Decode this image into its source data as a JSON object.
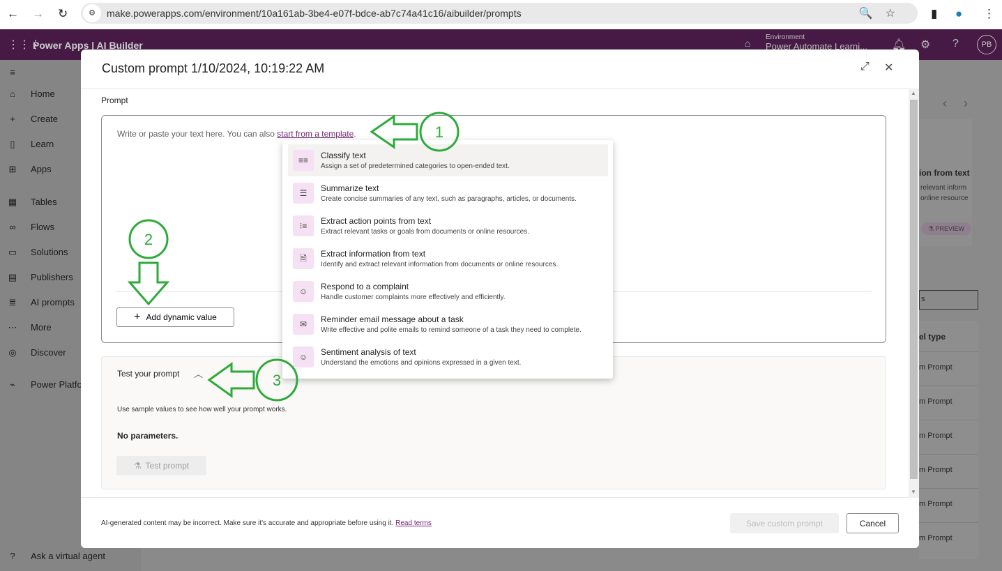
{
  "browser": {
    "url": "make.powerapps.com/environment/10a161ab-3be4-e07f-bdce-ab7c74a41c16/aibuilder/prompts"
  },
  "app": {
    "title": "Power Apps | AI Builder",
    "environment_label": "Environment",
    "environment_name": "Power Automate Learni...",
    "avatar": "PB"
  },
  "sidebar": {
    "items": [
      {
        "icon": "home-icon",
        "label": "Home"
      },
      {
        "icon": "plus-icon",
        "label": "Create"
      },
      {
        "icon": "book-icon",
        "label": "Learn"
      },
      {
        "icon": "apps-icon",
        "label": "Apps"
      },
      {
        "icon": "table-icon",
        "label": "Tables"
      },
      {
        "icon": "flow-icon",
        "label": "Flows"
      },
      {
        "icon": "solutions-icon",
        "label": "Solutions"
      },
      {
        "icon": "publisher-icon",
        "label": "Publishers"
      },
      {
        "icon": "ai-prompts-icon",
        "label": "AI prompts"
      },
      {
        "icon": "more-icon",
        "label": "More"
      },
      {
        "icon": "discover-icon",
        "label": "Discover"
      },
      {
        "icon": "power-platform-icon",
        "label": "Power Platfo"
      }
    ],
    "bottom": "Ask a virtual agent"
  },
  "background": {
    "card_title": "ion from text",
    "card_desc1": "relevant inform",
    "card_desc2": "online resource",
    "badge": "PREVIEW",
    "search_partial": "s",
    "column_header": "el type",
    "rows": [
      "m Prompt",
      "m Prompt",
      "m Prompt",
      "m Prompt",
      "m Prompt",
      "m Prompt"
    ]
  },
  "modal": {
    "title": "Custom prompt 1/10/2024, 10:19:22 AM",
    "prompt_label": "Prompt",
    "placeholder_prefix": "Write or paste your text here. You can also ",
    "template_link": "start from a template",
    "placeholder_suffix": ".",
    "add_dynamic_value": "Add dynamic value",
    "test": {
      "header": "Test your prompt",
      "description": "Use sample values to see how well your prompt works.",
      "no_params": "No parameters.",
      "button": "Test prompt"
    },
    "footer_text": "AI-generated content may be incorrect. Make sure it's accurate and appropriate before using it. ",
    "read_terms": "Read terms",
    "save": "Save custom prompt",
    "cancel": "Cancel"
  },
  "templates": [
    {
      "icon": "classify-icon",
      "glyph": "≡≡",
      "title": "Classify text",
      "desc": "Assign a set of predetermined categories to open-ended text."
    },
    {
      "icon": "summarize-icon",
      "glyph": "☰",
      "title": "Summarize text",
      "desc": "Create concise summaries of any text, such as paragraphs, articles, or documents."
    },
    {
      "icon": "list-icon",
      "glyph": "⁝≡",
      "title": "Extract action points from text",
      "desc": "Extract relevant tasks or goals from documents or online resources."
    },
    {
      "icon": "document-icon",
      "glyph": "🗎",
      "title": "Extract information from text",
      "desc": "Identify and extract relevant information from documents or online resources."
    },
    {
      "icon": "person-feedback-icon",
      "glyph": "☺",
      "title": "Respond to a complaint",
      "desc": "Handle customer complaints more effectively and efficiently."
    },
    {
      "icon": "mail-clock-icon",
      "glyph": "✉",
      "title": "Reminder email message about a task",
      "desc": "Write effective and polite emails to remind someone of a task they need to complete."
    },
    {
      "icon": "emoji-icon",
      "glyph": "☺",
      "title": "Sentiment analysis of text",
      "desc": "Understand the emotions and opinions expressed in a given text."
    }
  ],
  "annotations": [
    "1",
    "2",
    "3"
  ],
  "colors": {
    "accent": "#742774",
    "header": "#461a45",
    "annotation": "#2eaa3a"
  }
}
